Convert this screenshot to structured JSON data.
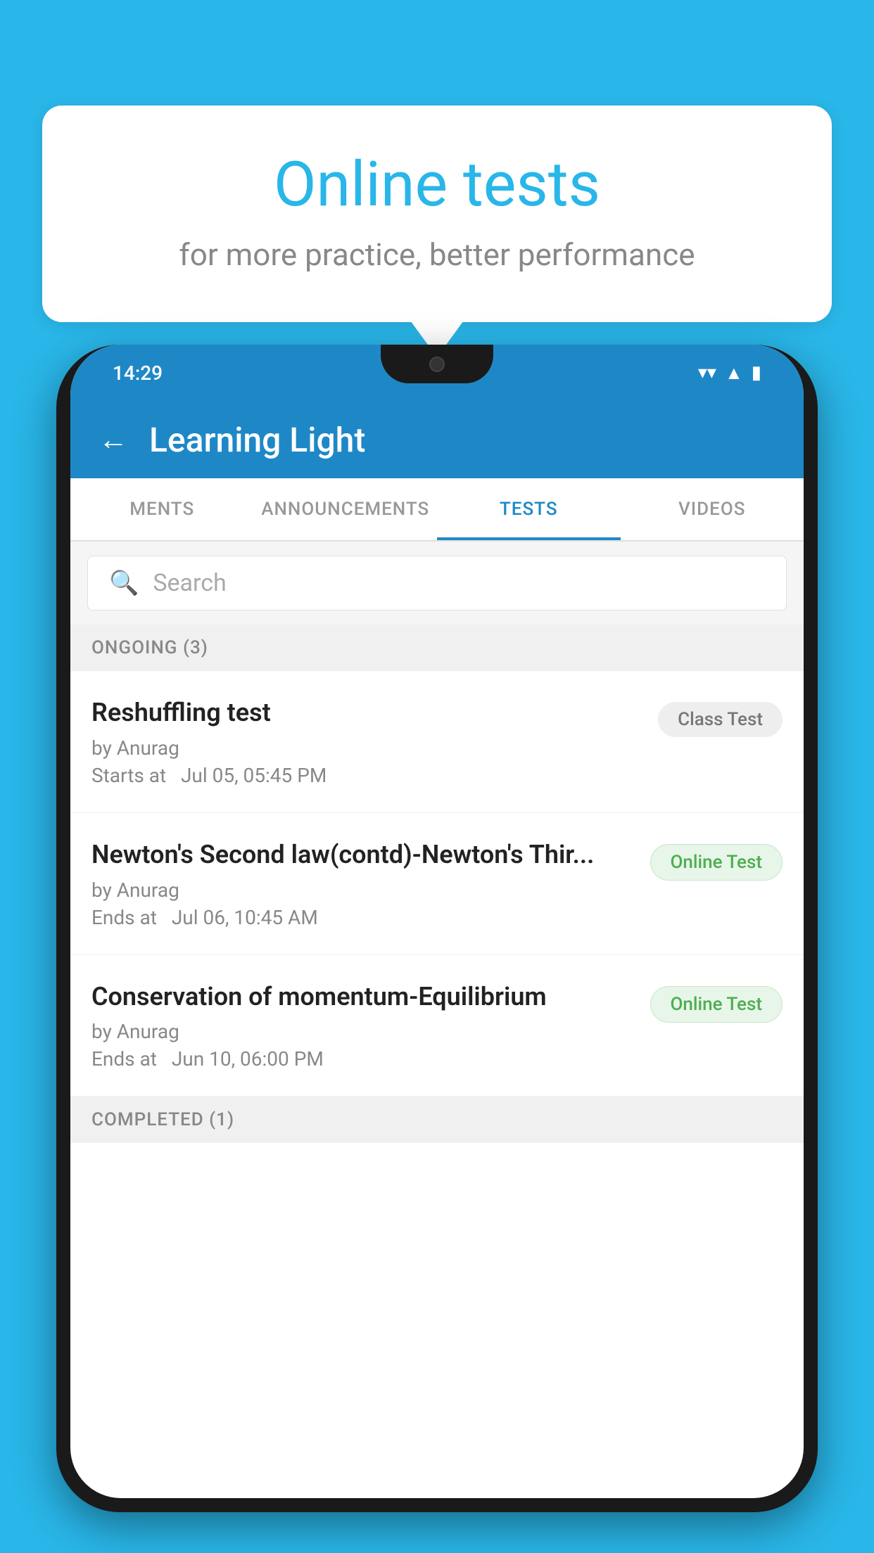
{
  "background": {
    "color": "#29b6e8"
  },
  "speech_bubble": {
    "title": "Online tests",
    "subtitle": "for more practice, better performance"
  },
  "phone": {
    "status_bar": {
      "time": "14:29",
      "wifi_icon": "▼",
      "signal_icon": "▲",
      "battery_icon": "▮"
    },
    "app_bar": {
      "back_label": "←",
      "title": "Learning Light"
    },
    "tabs": [
      {
        "label": "MENTS",
        "active": false
      },
      {
        "label": "ANNOUNCEMENTS",
        "active": false
      },
      {
        "label": "TESTS",
        "active": true
      },
      {
        "label": "VIDEOS",
        "active": false
      }
    ],
    "search": {
      "placeholder": "Search"
    },
    "sections": [
      {
        "title": "ONGOING (3)",
        "items": [
          {
            "name": "Reshuffling test",
            "author": "by Anurag",
            "time_label": "Starts at",
            "time": "Jul 05, 05:45 PM",
            "badge": "Class Test",
            "badge_type": "class"
          },
          {
            "name": "Newton's Second law(contd)-Newton's Thir...",
            "author": "by Anurag",
            "time_label": "Ends at",
            "time": "Jul 06, 10:45 AM",
            "badge": "Online Test",
            "badge_type": "online"
          },
          {
            "name": "Conservation of momentum-Equilibrium",
            "author": "by Anurag",
            "time_label": "Ends at",
            "time": "Jun 10, 06:00 PM",
            "badge": "Online Test",
            "badge_type": "online"
          }
        ]
      },
      {
        "title": "COMPLETED (1)",
        "items": []
      }
    ]
  }
}
